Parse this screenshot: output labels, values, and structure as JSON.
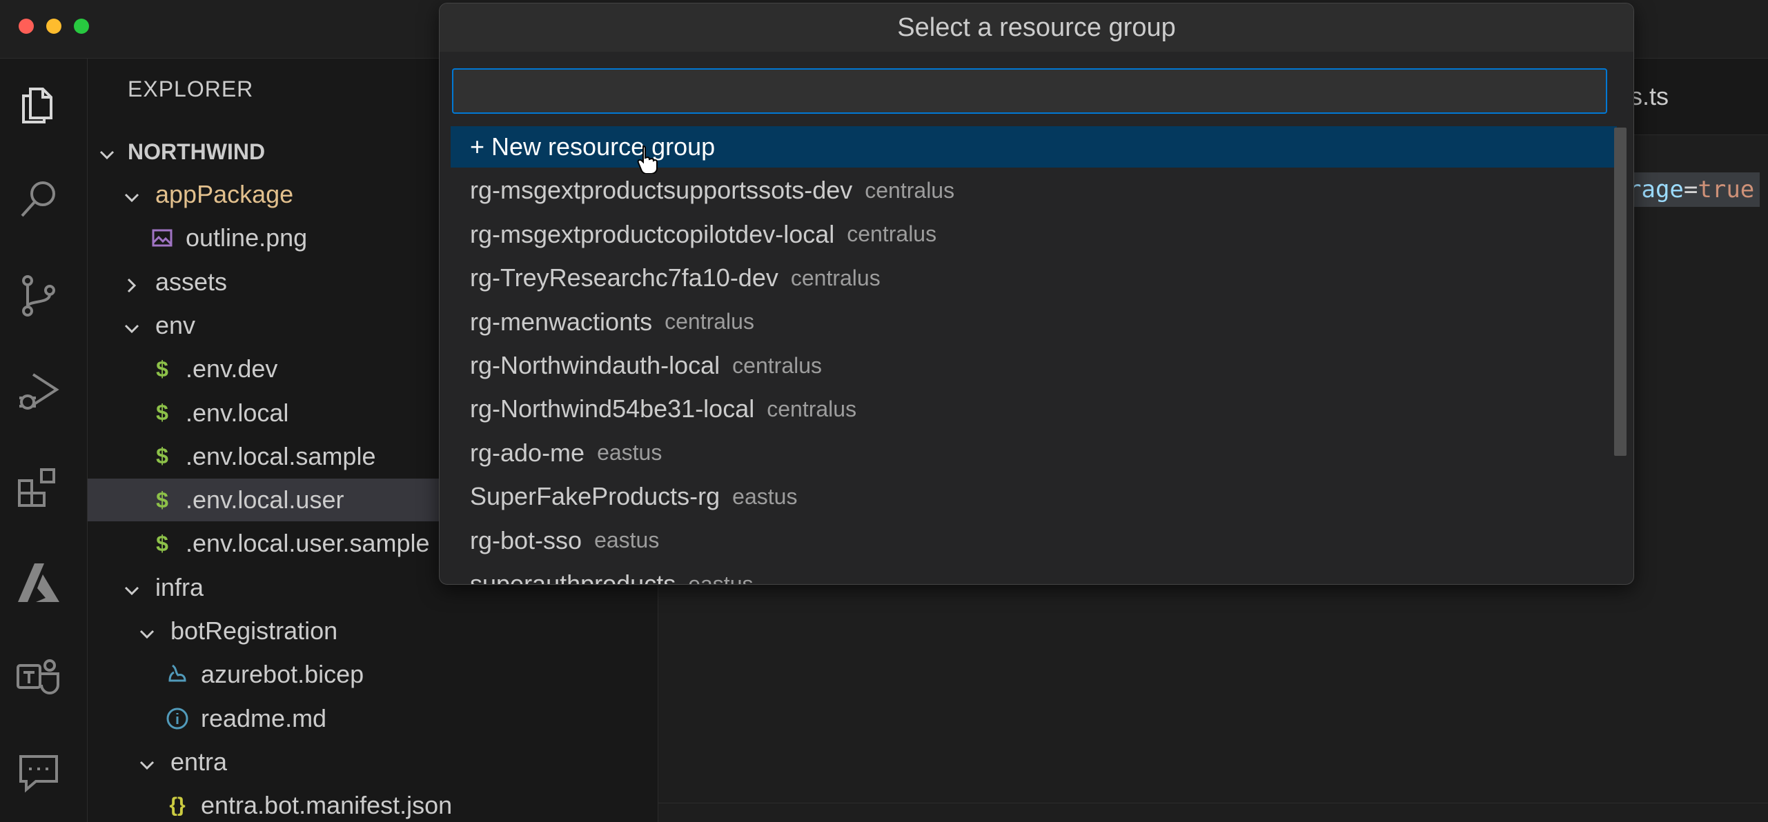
{
  "window": {
    "traffic_lights": [
      "#ff5f57",
      "#febc2e",
      "#28c840"
    ]
  },
  "activity_bar": {
    "items": [
      {
        "icon": "files-icon"
      },
      {
        "icon": "search-icon"
      },
      {
        "icon": "source-control-icon"
      },
      {
        "icon": "run-debug-icon"
      },
      {
        "icon": "extensions-icon"
      },
      {
        "icon": "azure-icon"
      },
      {
        "icon": "teams-icon"
      },
      {
        "icon": "chat-feedback-icon"
      }
    ]
  },
  "explorer": {
    "title": "EXPLORER",
    "workspace": "NORTHWIND",
    "rows": [
      {
        "label": "appPackage",
        "kind": "folder-open",
        "indent": 1,
        "color": "#e2c08d"
      },
      {
        "label": "outline.png",
        "kind": "image",
        "indent": 2
      },
      {
        "label": "assets",
        "kind": "folder-closed",
        "indent": 1
      },
      {
        "label": "env",
        "kind": "folder-open",
        "indent": 1
      },
      {
        "label": ".env.dev",
        "kind": "dollar",
        "indent": 2
      },
      {
        "label": ".env.local",
        "kind": "dollar",
        "indent": 2
      },
      {
        "label": ".env.local.sample",
        "kind": "dollar",
        "indent": 2
      },
      {
        "label": ".env.local.user",
        "kind": "dollar",
        "indent": 2,
        "selected": true
      },
      {
        "label": ".env.local.user.sample",
        "kind": "dollar",
        "indent": 2
      },
      {
        "label": "infra",
        "kind": "folder-open",
        "indent": 1
      },
      {
        "label": "botRegistration",
        "kind": "folder-open",
        "indent": 2
      },
      {
        "label": "azurebot.bicep",
        "kind": "bicep",
        "indent": 3
      },
      {
        "label": "readme.md",
        "kind": "info",
        "indent": 3
      },
      {
        "label": "entra",
        "kind": "folder-open",
        "indent": 2
      },
      {
        "label": "entra.bot.manifest.json",
        "kind": "braces",
        "indent": 3
      }
    ]
  },
  "editor": {
    "tab_fragment": "ls.ts",
    "code_fragment_a": "rage",
    "code_fragment_eq": "=",
    "code_fragment_b": "true"
  },
  "quick_pick": {
    "title": "Select a resource group",
    "input_value": "",
    "input_placeholder": "",
    "items": [
      {
        "label": "+ New resource group",
        "description": "",
        "active": true
      },
      {
        "label": "rg-msgextproductsupportssots-dev",
        "description": "centralus"
      },
      {
        "label": "rg-msgextproductcopilotdev-local",
        "description": "centralus"
      },
      {
        "label": "rg-TreyResearchc7fa10-dev",
        "description": "centralus"
      },
      {
        "label": "rg-menwactionts",
        "description": "centralus"
      },
      {
        "label": "rg-Northwindauth-local",
        "description": "centralus"
      },
      {
        "label": "rg-Northwind54be31-local",
        "description": "centralus"
      },
      {
        "label": "rg-ado-me",
        "description": "eastus"
      },
      {
        "label": "SuperFakeProducts-rg",
        "description": "eastus"
      },
      {
        "label": "rg-bot-sso",
        "description": "eastus"
      },
      {
        "label": "superauthproducts",
        "description": "eastus"
      }
    ]
  }
}
